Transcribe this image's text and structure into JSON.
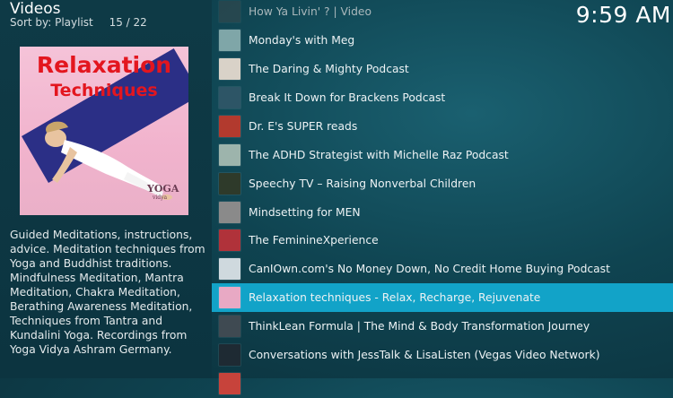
{
  "header": {
    "title": "Videos",
    "sort_label": "Sort by: Playlist",
    "position": "15 / 22"
  },
  "clock": "9:59 AM",
  "thumbnail": {
    "title_line1": "Relaxation",
    "title_line2": "Techniques",
    "logo": "YOGA",
    "logo_sub": "vidya"
  },
  "description": "Guided Meditations, instructions, advice. Meditation techniques from Yoga and Buddhist traditions. Mindfulness Meditation, Mantra Meditation, Chakra Meditation, Berathing Awareness Meditation, Techniques from Tantra and Kundalini Yoga. Recordings from Yoga Vidya Ashram Germany.",
  "colors": {
    "selected": "#12a3c8",
    "background": "#0f4451",
    "accent_red": "#e3161f"
  },
  "items": [
    {
      "label": "How Ya Livin' ? | Video",
      "icon": "podcast-cover-icon",
      "color": "#3a4a4e"
    },
    {
      "label": "Monday's with Meg",
      "icon": "podcast-cover-icon",
      "color": "#7fa6a8"
    },
    {
      "label": "The Daring & Mighty Podcast",
      "icon": "podcast-cover-icon",
      "color": "#d9d2c8"
    },
    {
      "label": "Break It Down for Brackens Podcast",
      "icon": "podcast-cover-icon",
      "color": "#2d5566"
    },
    {
      "label": "Dr. E's SUPER reads",
      "icon": "podcast-cover-icon",
      "color": "#b23a2e"
    },
    {
      "label": "The ADHD Strategist with Michelle Raz Podcast",
      "icon": "podcast-cover-icon",
      "color": "#9db4ac"
    },
    {
      "label": "Speechy TV – Raising Nonverbal Children",
      "icon": "podcast-cover-icon",
      "color": "#2e3a2a"
    },
    {
      "label": "Mindsetting for MEN",
      "icon": "podcast-cover-icon",
      "color": "#8a8a8a"
    },
    {
      "label": "The FeminineXperience",
      "icon": "podcast-cover-icon",
      "color": "#b0323a"
    },
    {
      "label": "CanIOwn.com's No Money Down, No Credit Home Buying Podcast",
      "icon": "podcast-cover-icon",
      "color": "#cfd9de"
    },
    {
      "label": "Relaxation techniques - Relax, Recharge, Rejuvenate",
      "icon": "podcast-cover-icon",
      "color": "#e8a9c4",
      "selected": true
    },
    {
      "label": "ThinkLean Formula | The Mind & Body Transformation Journey",
      "icon": "podcast-cover-icon",
      "color": "#3f4a52"
    },
    {
      "label": "Conversations with JessTalk & LisaListen (Vegas Video Network)",
      "icon": "podcast-cover-icon",
      "color": "#1e2a33"
    },
    {
      "label": "",
      "icon": "podcast-cover-icon",
      "color": "#c7433b"
    }
  ]
}
